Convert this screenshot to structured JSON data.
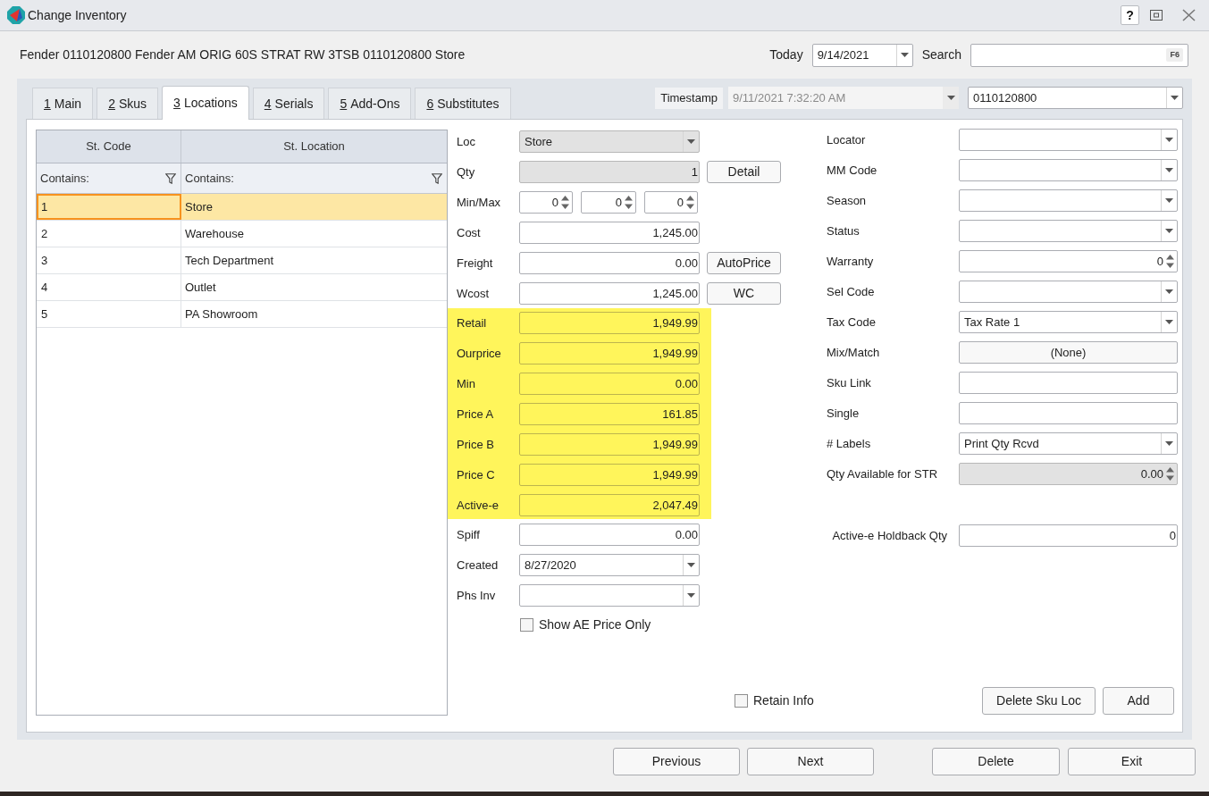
{
  "window": {
    "title": "Change Inventory",
    "help_button": "?"
  },
  "header": {
    "description": "Fender 0110120800 Fender AM ORIG 60S STRAT RW 3TSB 0110120800 Store",
    "today": {
      "label": "Today",
      "value": "9/14/2021"
    },
    "search": {
      "label": "Search",
      "hotkey": "F6"
    }
  },
  "tabs": [
    {
      "number": "1",
      "label": "Main",
      "selected": false
    },
    {
      "number": "2",
      "label": "Skus",
      "selected": false
    },
    {
      "number": "3",
      "label": "Locations",
      "selected": true
    },
    {
      "number": "4",
      "label": "Serials",
      "selected": false
    },
    {
      "number": "5",
      "label": "Add-Ons",
      "selected": false
    },
    {
      "number": "6",
      "label": "Substitutes",
      "selected": false
    }
  ],
  "timestamp": {
    "label": "Timestamp",
    "value": "9/11/2021 7:32:20 AM",
    "disabled": true
  },
  "sku": {
    "value": "0110120800"
  },
  "locations_grid": {
    "columns": [
      {
        "title": "St. Code",
        "filter": "Contains:"
      },
      {
        "title": "St. Location",
        "filter": "Contains:"
      }
    ],
    "rows": [
      {
        "cells": [
          "1",
          "Store"
        ],
        "selected": true
      },
      {
        "cells": [
          "2",
          "Warehouse"
        ],
        "selected": false
      },
      {
        "cells": [
          "3",
          "Tech Department"
        ],
        "selected": false
      },
      {
        "cells": [
          "4",
          "Outlet"
        ],
        "selected": false
      },
      {
        "cells": [
          "5",
          "PA Showroom"
        ],
        "selected": false
      }
    ]
  },
  "location_form": {
    "sections": [
      {
        "highlighted": false,
        "fields": [
          {
            "kind": "combo",
            "label": "Loc",
            "value": "Store",
            "disabled": true
          },
          {
            "kind": "number",
            "label": "Qty",
            "value": "1",
            "disabled": true,
            "button": {
              "label": "Detail"
            }
          },
          {
            "kind": "spinners",
            "label": "Min/Max",
            "values": [
              "0",
              "0",
              "0"
            ],
            "disabled": false
          },
          {
            "kind": "number",
            "label": "Cost",
            "value": "1,245.00",
            "disabled": false
          },
          {
            "kind": "number",
            "label": "Freight",
            "value": "0.00",
            "disabled": false,
            "button": {
              "label": "AutoPrice"
            }
          },
          {
            "kind": "number",
            "label": "Wcost",
            "value": "1,245.00",
            "disabled": false,
            "button": {
              "label": "WC"
            }
          }
        ]
      },
      {
        "highlighted": true,
        "fields": [
          {
            "kind": "number",
            "label": "Retail",
            "value": "1,949.99",
            "disabled": false
          },
          {
            "kind": "number",
            "label": "Ourprice",
            "value": "1,949.99",
            "disabled": false
          },
          {
            "kind": "number",
            "label": "Min",
            "value": "0.00",
            "disabled": false
          },
          {
            "kind": "number",
            "label": "Price A",
            "value": "161.85",
            "disabled": false
          },
          {
            "kind": "number",
            "label": "Price B",
            "value": "1,949.99",
            "disabled": false
          },
          {
            "kind": "number",
            "label": "Price C",
            "value": "1,949.99",
            "disabled": false
          },
          {
            "kind": "number",
            "label": "Active-e",
            "value": "2,047.49",
            "disabled": false
          }
        ]
      },
      {
        "highlighted": false,
        "fields": [
          {
            "kind": "number",
            "label": "Spiff",
            "value": "0.00",
            "disabled": false
          },
          {
            "kind": "combo",
            "label": "Created",
            "value": "8/27/2020",
            "disabled": false
          },
          {
            "kind": "combo",
            "label": "Phs Inv",
            "disabled": false
          }
        ]
      }
    ],
    "show_ae_price_only": {
      "label": "Show AE Price Only",
      "checked": false
    }
  },
  "details_form": {
    "fields": [
      {
        "kind": "combo",
        "label": "Locator",
        "disabled": false
      },
      {
        "kind": "combo",
        "label": "MM Code",
        "disabled": false
      },
      {
        "kind": "combo",
        "label": "Season",
        "disabled": false
      },
      {
        "kind": "combo",
        "label": "Status",
        "disabled": false
      },
      {
        "kind": "spin",
        "label": "Warranty",
        "value": "0",
        "disabled": false
      },
      {
        "kind": "combo",
        "label": "Sel Code",
        "disabled": false
      },
      {
        "kind": "combo",
        "label": "Tax Code",
        "value": "Tax Rate 1",
        "disabled": false
      },
      {
        "kind": "picker",
        "label": "Mix/Match",
        "value": "(None)",
        "disabled": false
      },
      {
        "kind": "text",
        "label": "Sku Link",
        "disabled": false
      },
      {
        "kind": "text",
        "label": "Single",
        "disabled": false
      },
      {
        "kind": "combo",
        "label": "# Labels",
        "value": "Print Qty Rcvd",
        "disabled": false
      },
      {
        "kind": "spin",
        "label": "Qty Available for STR",
        "value": "0.00",
        "disabled": true
      }
    ],
    "holdback": {
      "label": "Active-e Holdback Qty",
      "value": "0"
    }
  },
  "retain_info": {
    "label": "Retain Info",
    "checked": false
  },
  "location_buttons": [
    {
      "label": "Delete Sku Loc"
    },
    {
      "label": "Add"
    }
  ],
  "navigation_buttons": [
    {
      "label": "Previous"
    },
    {
      "label": "Next"
    }
  ],
  "action_buttons": [
    {
      "label": "Delete"
    },
    {
      "label": "Exit"
    }
  ]
}
